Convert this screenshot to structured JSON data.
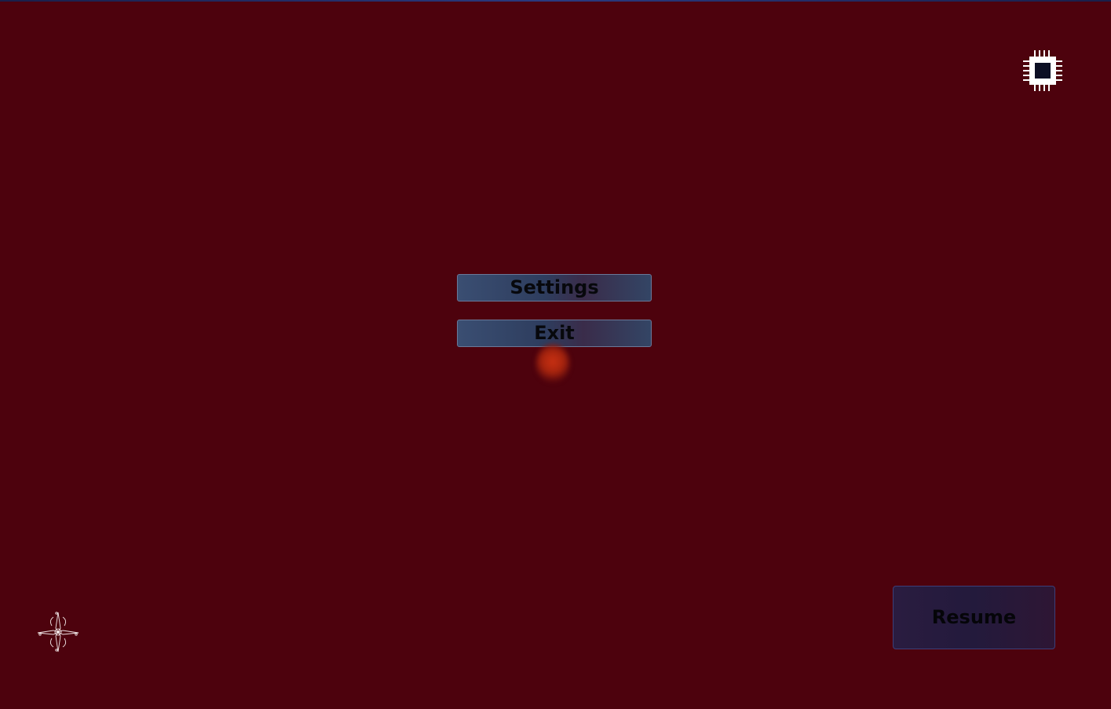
{
  "menu": {
    "settings_label": "Settings",
    "exit_label": "Exit"
  },
  "resume": {
    "label": "Resume"
  },
  "icons": {
    "top_right": "cpu-chip-icon",
    "bottom_left": "compass-star-icon"
  },
  "colors": {
    "background": "#4d020d",
    "menu_button": "#34446a",
    "resume_button": "#261b3e",
    "glow": "#c83012"
  }
}
